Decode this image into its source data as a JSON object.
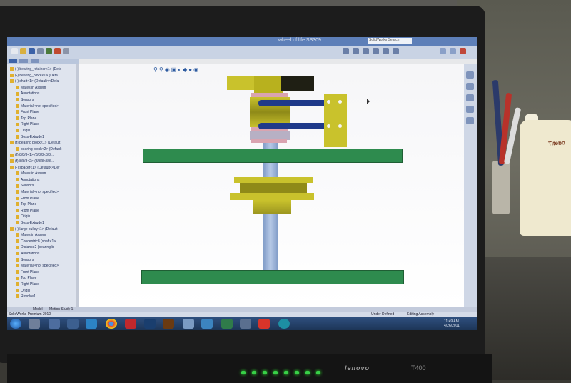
{
  "window": {
    "title": "wheel of life SS309",
    "search_placeholder": "SolidWorks Search"
  },
  "feature_tree": {
    "items": [
      "(-) bearing_retainer<1> (Defa",
      "(-) bearing_block<1> (Defa",
      "(-) shaft<1> (Default<<Defa",
      "Mates in Assem",
      "Annotations",
      "Sensors",
      "Material <not specified>",
      "Front Plane",
      "Top Plane",
      "Right Plane",
      "Origin",
      "Boss-Extrude1",
      "(f) bearing block<1> (Default",
      "bearing block<2> (Default",
      "(f) 8/8/8<1> (8/8/8<8/8...",
      "(f) 8/8/8<2> (8/8/8<8/8...",
      "(-) spacer<1> (Default<<Def",
      "Mates in Assem",
      "Annotations",
      "Sensors",
      "Material <not specified>",
      "Front Plane",
      "Top Plane",
      "Right Plane",
      "Origin",
      "Boss-Extrude1",
      "(-) large pulley<1> (Default",
      "Mates in Assem",
      "Concentric8 (shaft<1>",
      "Distance2 (bearing bl",
      "Annotations",
      "Sensors",
      "Material <not specified>",
      "Front Plane",
      "Top Plane",
      "Right Plane",
      "Origin",
      "Revolve1"
    ]
  },
  "bottom_tabs": [
    "Model",
    "Motion Study 1"
  ],
  "status": {
    "app": "SolidWorks Premium 2010",
    "state": "Under Defined",
    "mode": "Editing Assembly"
  },
  "taskbar": {
    "time": "11:49 AM",
    "date": "4/26/2011"
  },
  "laptop": {
    "brand": "lenovo",
    "model": "T400"
  },
  "bottle_label": "Titebo",
  "icons": [
    "windows-start-icon",
    "chrome-icon",
    "filezilla-icon",
    "photoshop-icon",
    "illustrator-icon",
    "arduino-icon"
  ],
  "colors": {
    "accent": "#5d7fb8",
    "plate_green": "#2e8b4e",
    "shaft_blue": "#8aa6cf",
    "block_olive": "#c7c327",
    "linkage_navy": "#1f3a8a"
  }
}
